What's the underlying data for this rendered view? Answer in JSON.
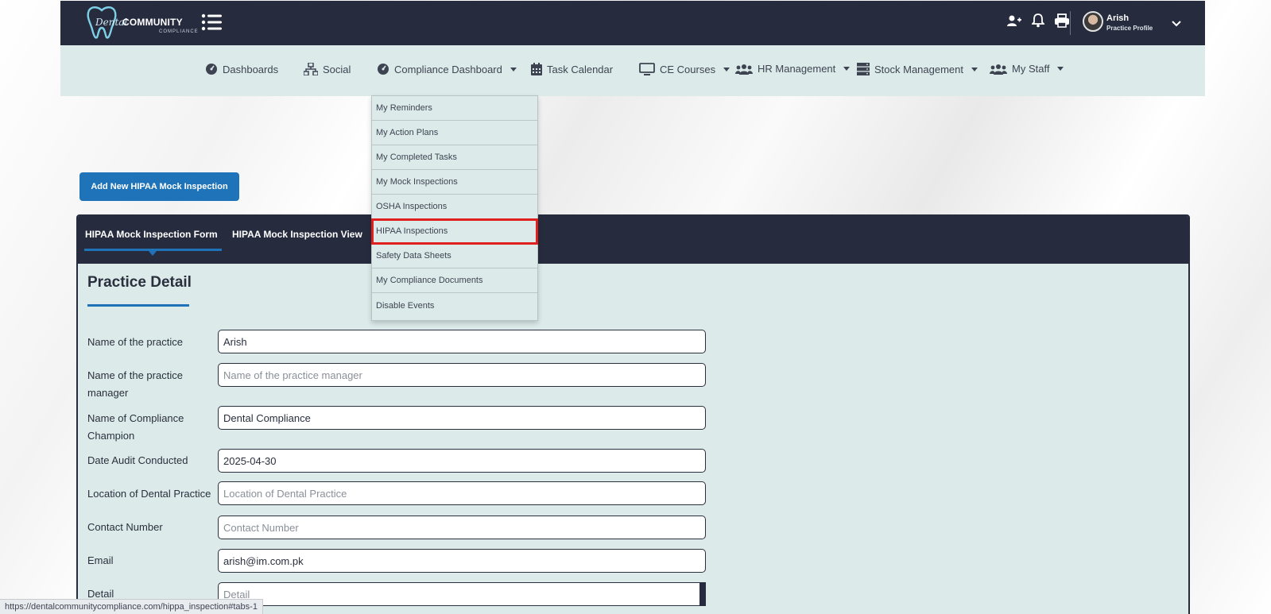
{
  "header": {
    "logo_script": "Dental",
    "logo_text": "COMMUNITY",
    "logo_sub": "COMPLIANCE",
    "user_name": "Arish",
    "user_sub": "Practice Profile"
  },
  "nav": {
    "items": [
      {
        "label": "Dashboards",
        "icon": "gauge-icon",
        "has_caret": false
      },
      {
        "label": "Social",
        "icon": "sitemap-icon",
        "has_caret": false
      },
      {
        "label": "Compliance Dashboard",
        "icon": "gauge-icon",
        "has_caret": true
      },
      {
        "label": "Task Calendar",
        "icon": "calendar-icon",
        "has_caret": false
      },
      {
        "label": "CE Courses",
        "icon": "monitor-icon",
        "has_caret": true
      },
      {
        "label": "HR Management",
        "icon": "users-icon",
        "has_caret": true
      },
      {
        "label": "Stock Management",
        "icon": "server-icon",
        "has_caret": true
      },
      {
        "label": "My Staff",
        "icon": "users-icon",
        "has_caret": true
      }
    ]
  },
  "dropdown": {
    "items": [
      "My Reminders",
      "My Action Plans",
      "My Completed Tasks",
      "My Mock Inspections",
      "OSHA Inspections",
      "HIPAA Inspections",
      "Safety Data Sheets",
      "My Compliance Documents",
      "Disable Events"
    ],
    "highlighted": "HIPAA Inspections"
  },
  "actions": {
    "add_button": "Add New HIPAA Mock Inspection"
  },
  "tabs": {
    "form": "HIPAA Mock Inspection Form",
    "view": "HIPAA Mock Inspection View"
  },
  "form": {
    "section_title": "Practice Detail",
    "fields": {
      "practice_name": {
        "label": "Name of the practice",
        "value": "Arish",
        "placeholder": ""
      },
      "practice_manager": {
        "label": "Name of the practice manager",
        "value": "",
        "placeholder": "Name of the practice manager"
      },
      "compliance_champion": {
        "label": "Name of Compliance Champion",
        "value": "Dental Compliance",
        "placeholder": ""
      },
      "date_audit": {
        "label": "Date Audit Conducted",
        "value": "2025-04-30",
        "placeholder": ""
      },
      "location": {
        "label": "Location of Dental Practice",
        "value": "",
        "placeholder": "Location of Dental Practice"
      },
      "contact": {
        "label": "Contact Number",
        "value": "",
        "placeholder": "Contact Number"
      },
      "email": {
        "label": "Email",
        "value": "arish@im.com.pk",
        "placeholder": ""
      },
      "detail": {
        "label": "Detail",
        "value": "",
        "placeholder": "Detail"
      }
    }
  },
  "status_bar": {
    "url": "https://dentalcommunitycompliance.com/hippa_inspection#tabs-1"
  },
  "colors": {
    "header_bg": "#262b3e",
    "nav_bg": "#dcebea",
    "accent": "#1f74b9",
    "highlight": "#e0201f"
  }
}
